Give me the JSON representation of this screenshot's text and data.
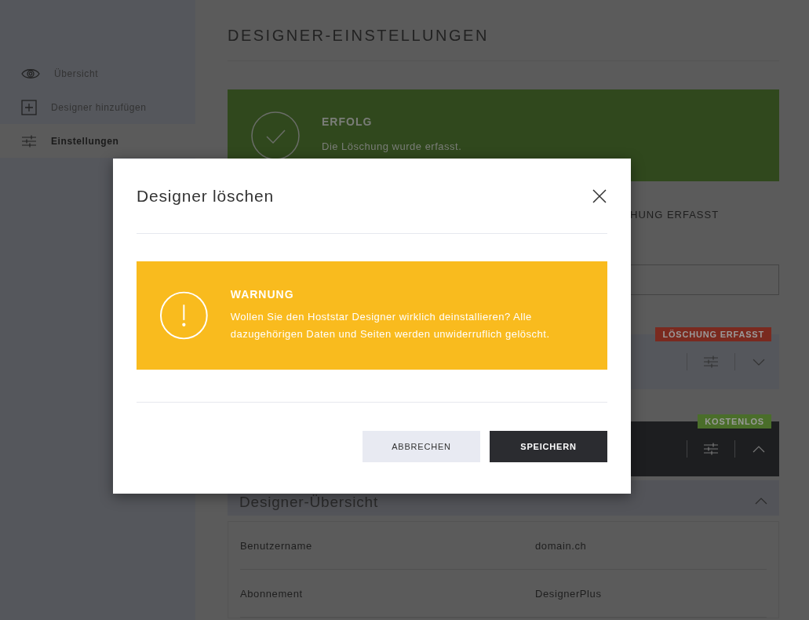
{
  "sidebar": {
    "items": [
      {
        "label": "Übersicht",
        "selected": false
      },
      {
        "label": "Designer hinzufügen",
        "selected": false
      },
      {
        "label": "Einstellungen",
        "selected": true
      }
    ]
  },
  "page_title": "DESIGNER-EINSTELLUNGEN",
  "success_alert": {
    "title": "ERFOLG",
    "message": "Die Löschung wurde erfasst."
  },
  "status_text": "HUNG ERFASST",
  "designers": [
    {
      "kind": "light",
      "badge": {
        "label": "LÖSCHUNG ERFASST",
        "color": "#7a2a1f"
      },
      "expanded": false
    },
    {
      "kind": "dark",
      "badge": {
        "label": "KOSTENLOS",
        "color": "#4a6e2a"
      },
      "expanded": true
    }
  ],
  "overview": {
    "title": "Designer-Übersicht",
    "expanded": true,
    "rows": [
      {
        "label": "Benutzername",
        "value": "domain.ch"
      },
      {
        "label": "Abonnement",
        "value": "DesignerPlus"
      }
    ]
  },
  "dialog": {
    "title": "Designer löschen",
    "warning": {
      "title": "WARNUNG",
      "message": "Wollen Sie den Hoststar Designer wirklich deinstallieren? Alle dazugehörigen Daten und Seiten werden unwiderruflich gelöscht."
    },
    "buttons": [
      {
        "label": "ABBRECHEN",
        "kind": "secondary"
      },
      {
        "label": "SPEICHERN",
        "kind": "primary"
      }
    ]
  }
}
